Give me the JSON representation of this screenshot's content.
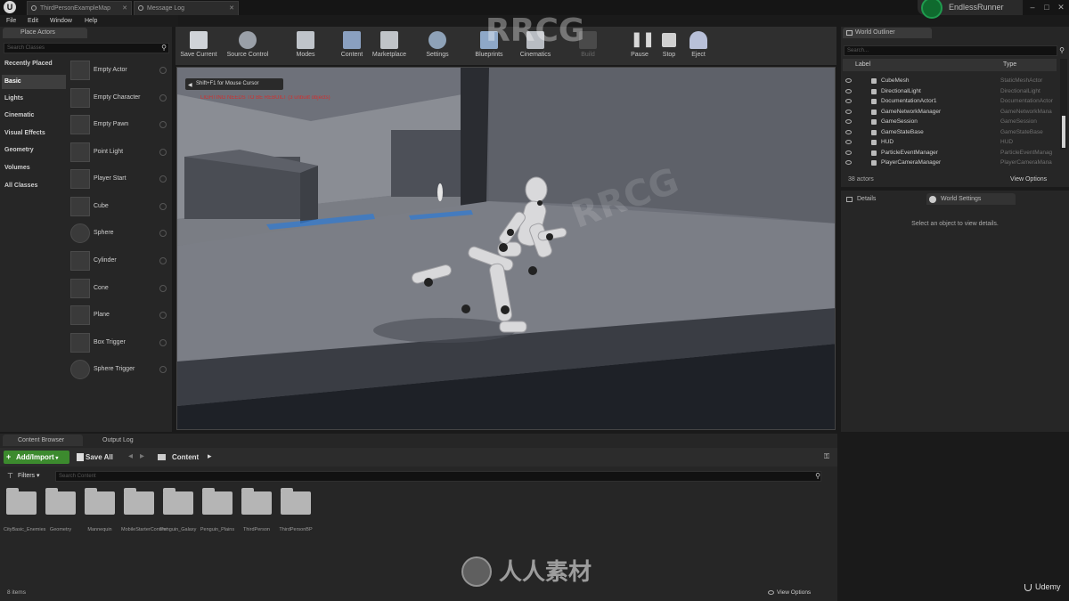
{
  "titlebar": {
    "tabs": [
      "ThirdPersonExampleMap",
      "Message Log"
    ],
    "project": "EndlessRunner",
    "win_controls": [
      "–",
      "□",
      "✕"
    ]
  },
  "menu": [
    "File",
    "Edit",
    "Window",
    "Help"
  ],
  "place_actors": {
    "tab": "Place Actors",
    "search_placeholder": "Search Classes",
    "categories": [
      "Recently Placed",
      "Basic",
      "Lights",
      "Cinematic",
      "Visual Effects",
      "Geometry",
      "Volumes",
      "All Classes"
    ],
    "selected_category": "Basic",
    "items": [
      "Empty Actor",
      "Empty Character",
      "Empty Pawn",
      "Point Light",
      "Player Start",
      "Cube",
      "Sphere",
      "Cylinder",
      "Cone",
      "Plane",
      "Box Trigger",
      "Sphere Trigger"
    ]
  },
  "toolbar": [
    {
      "label": "Save Current",
      "icon": "save-icon",
      "enabled": true
    },
    {
      "label": "Source Control",
      "icon": "source-control-icon",
      "enabled": true
    },
    {
      "label": "Modes",
      "icon": "modes-icon",
      "enabled": true
    },
    {
      "label": "Content",
      "icon": "content-icon",
      "enabled": true
    },
    {
      "label": "Marketplace",
      "icon": "marketplace-icon",
      "enabled": true
    },
    {
      "label": "Settings",
      "icon": "settings-icon",
      "enabled": true
    },
    {
      "label": "Blueprints",
      "icon": "blueprints-icon",
      "enabled": true
    },
    {
      "label": "Cinematics",
      "icon": "cinematics-icon",
      "enabled": true
    },
    {
      "label": "Build",
      "icon": "build-icon",
      "enabled": false
    },
    {
      "label": "Pause",
      "icon": "pause-icon",
      "enabled": true
    },
    {
      "label": "Stop",
      "icon": "stop-icon",
      "enabled": true
    },
    {
      "label": "Eject",
      "icon": "eject-icon",
      "enabled": true
    }
  ],
  "viewport": {
    "hint": "Shift+F1 for Mouse Cursor",
    "red_text": "LIGHTING NEEDS TO BE REBUILT (3 unbuilt objects)"
  },
  "outliner": {
    "tab": "World Outliner",
    "search_placeholder": "Search...",
    "col_label": "Label",
    "col_type": "Type",
    "rows": [
      {
        "name": "CubeMesh",
        "type": "StaticMeshActor"
      },
      {
        "name": "DirectionalLight",
        "type": "DirectionalLight"
      },
      {
        "name": "DocumentationActor1",
        "type": "DocumentationActor"
      },
      {
        "name": "GameNetworkManager",
        "type": "GameNetworkMana"
      },
      {
        "name": "GameSession",
        "type": "GameSession"
      },
      {
        "name": "GameStateBase",
        "type": "GameStateBase"
      },
      {
        "name": "HUD",
        "type": "HUD"
      },
      {
        "name": "ParticleEventManager",
        "type": "ParticleEventManag"
      },
      {
        "name": "PlayerCameraManager",
        "type": "PlayerCameraMana"
      }
    ],
    "count": "38 actors",
    "view_options": "View Options"
  },
  "details": {
    "tab_details": "Details",
    "tab_world": "World Settings",
    "empty_msg": "Select an object to view details."
  },
  "content_browser": {
    "tab": "Content Browser",
    "tab_output": "Output Log",
    "add_import": "Add/Import",
    "save_all": "Save All",
    "path": "Content",
    "filters": "Filters",
    "search_placeholder": "Search Content",
    "folders": [
      "CityBasic_Enemies",
      "Geometry",
      "Mannequin",
      "MobileStarterContent",
      "Penguin_Galaxy",
      "Penguin_Plains",
      "ThirdPerson",
      "ThirdPersonBP"
    ],
    "count": "8 items",
    "view_options": "View Options"
  },
  "watermarks": {
    "top": "RRCG",
    "brand": "人人素材",
    "site": "RRCG",
    "udemy": "Udemy"
  }
}
